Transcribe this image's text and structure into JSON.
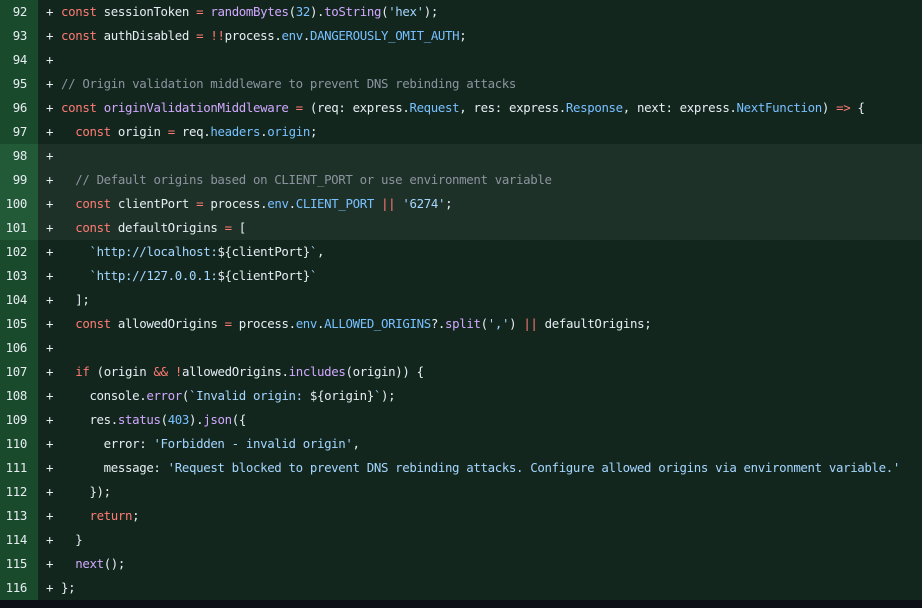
{
  "colors": {
    "keyword": "#ff7b72",
    "function": "#d2a8ff",
    "string": "#a5d6ff",
    "constant": "#79c0ff",
    "comment": "#8b949e",
    "plain": "#e6edf3",
    "added_line_bg": "#12261e",
    "added_gutter_bg": "#1a4a2c",
    "selected_line_bg": "#1e3128"
  },
  "lines": [
    {
      "num": "92",
      "marker": "+",
      "tokens": [
        [
          "kw",
          "const"
        ],
        [
          "plain",
          " sessionToken "
        ],
        [
          "kw",
          "="
        ],
        [
          "plain",
          " "
        ],
        [
          "fn",
          "randomBytes"
        ],
        [
          "plain",
          "("
        ],
        [
          "const",
          "32"
        ],
        [
          "plain",
          ")."
        ],
        [
          "fn",
          "toString"
        ],
        [
          "plain",
          "("
        ],
        [
          "str",
          "'hex'"
        ],
        [
          "plain",
          ");"
        ]
      ]
    },
    {
      "num": "93",
      "marker": "+",
      "tokens": [
        [
          "kw",
          "const"
        ],
        [
          "plain",
          " authDisabled "
        ],
        [
          "kw",
          "="
        ],
        [
          "plain",
          " "
        ],
        [
          "kw",
          "!!"
        ],
        [
          "plain",
          "process."
        ],
        [
          "const",
          "env"
        ],
        [
          "plain",
          "."
        ],
        [
          "const",
          "DANGEROUSLY_OMIT_AUTH"
        ],
        [
          "plain",
          ";"
        ]
      ]
    },
    {
      "num": "94",
      "marker": "+",
      "tokens": []
    },
    {
      "num": "95",
      "marker": "+",
      "tokens": [
        [
          "cm",
          "// Origin validation middleware to prevent DNS rebinding attacks"
        ]
      ]
    },
    {
      "num": "96",
      "marker": "+",
      "tokens": [
        [
          "kw",
          "const"
        ],
        [
          "plain",
          " "
        ],
        [
          "fn",
          "originValidationMiddleware"
        ],
        [
          "plain",
          " "
        ],
        [
          "kw",
          "="
        ],
        [
          "plain",
          " (req: express."
        ],
        [
          "const",
          "Request"
        ],
        [
          "plain",
          ", res: express."
        ],
        [
          "const",
          "Response"
        ],
        [
          "plain",
          ", next: express."
        ],
        [
          "const",
          "NextFunction"
        ],
        [
          "plain",
          ") "
        ],
        [
          "kw",
          "=>"
        ],
        [
          "plain",
          " {"
        ]
      ]
    },
    {
      "num": "97",
      "marker": "+",
      "tokens": [
        [
          "plain",
          "  "
        ],
        [
          "kw",
          "const"
        ],
        [
          "plain",
          " origin "
        ],
        [
          "kw",
          "="
        ],
        [
          "plain",
          " req."
        ],
        [
          "const",
          "headers"
        ],
        [
          "plain",
          "."
        ],
        [
          "const",
          "origin"
        ],
        [
          "plain",
          ";"
        ]
      ]
    },
    {
      "num": "98",
      "marker": "+",
      "hl": true,
      "tokens": []
    },
    {
      "num": "99",
      "marker": "+",
      "hl": true,
      "tokens": [
        [
          "plain",
          "  "
        ],
        [
          "cm",
          "// Default origins based on CLIENT_PORT or use environment variable"
        ]
      ]
    },
    {
      "num": "100",
      "marker": "+",
      "hl": true,
      "tokens": [
        [
          "plain",
          "  "
        ],
        [
          "kw",
          "const"
        ],
        [
          "plain",
          " clientPort "
        ],
        [
          "kw",
          "="
        ],
        [
          "plain",
          " process."
        ],
        [
          "const",
          "env"
        ],
        [
          "plain",
          "."
        ],
        [
          "const",
          "CLIENT_PORT"
        ],
        [
          "plain",
          " "
        ],
        [
          "kw",
          "||"
        ],
        [
          "plain",
          " "
        ],
        [
          "str",
          "'6274'"
        ],
        [
          "plain",
          ";"
        ]
      ]
    },
    {
      "num": "101",
      "marker": "+",
      "hl": true,
      "tokens": [
        [
          "plain",
          "  "
        ],
        [
          "kw",
          "const"
        ],
        [
          "plain",
          " defaultOrigins "
        ],
        [
          "kw",
          "="
        ],
        [
          "plain",
          " ["
        ]
      ]
    },
    {
      "num": "102",
      "marker": "+",
      "tokens": [
        [
          "plain",
          "    "
        ],
        [
          "str",
          "`http://localhost:"
        ],
        [
          "plain",
          "${clientPort}"
        ],
        [
          "str",
          "`"
        ],
        [
          "plain",
          ","
        ]
      ]
    },
    {
      "num": "103",
      "marker": "+",
      "tokens": [
        [
          "plain",
          "    "
        ],
        [
          "str",
          "`http://127.0.0.1:"
        ],
        [
          "plain",
          "${clientPort}"
        ],
        [
          "str",
          "`"
        ]
      ]
    },
    {
      "num": "104",
      "marker": "+",
      "tokens": [
        [
          "plain",
          "  ];"
        ]
      ]
    },
    {
      "num": "105",
      "marker": "+",
      "tokens": [
        [
          "plain",
          "  "
        ],
        [
          "kw",
          "const"
        ],
        [
          "plain",
          " allowedOrigins "
        ],
        [
          "kw",
          "="
        ],
        [
          "plain",
          " process."
        ],
        [
          "const",
          "env"
        ],
        [
          "plain",
          "."
        ],
        [
          "const",
          "ALLOWED_ORIGINS"
        ],
        [
          "plain",
          "?."
        ],
        [
          "fn",
          "split"
        ],
        [
          "plain",
          "("
        ],
        [
          "str",
          "','"
        ],
        [
          "plain",
          ") "
        ],
        [
          "kw",
          "||"
        ],
        [
          "plain",
          " defaultOrigins;"
        ]
      ]
    },
    {
      "num": "106",
      "marker": "+",
      "tokens": []
    },
    {
      "num": "107",
      "marker": "+",
      "tokens": [
        [
          "plain",
          "  "
        ],
        [
          "kw",
          "if"
        ],
        [
          "plain",
          " (origin "
        ],
        [
          "kw",
          "&&"
        ],
        [
          "plain",
          " "
        ],
        [
          "kw",
          "!"
        ],
        [
          "plain",
          "allowedOrigins."
        ],
        [
          "fn",
          "includes"
        ],
        [
          "plain",
          "(origin)) {"
        ]
      ]
    },
    {
      "num": "108",
      "marker": "+",
      "tokens": [
        [
          "plain",
          "    console."
        ],
        [
          "fn",
          "error"
        ],
        [
          "plain",
          "("
        ],
        [
          "str",
          "`Invalid origin: "
        ],
        [
          "plain",
          "${origin}"
        ],
        [
          "str",
          "`"
        ],
        [
          "plain",
          ");"
        ]
      ]
    },
    {
      "num": "109",
      "marker": "+",
      "tokens": [
        [
          "plain",
          "    res."
        ],
        [
          "fn",
          "status"
        ],
        [
          "plain",
          "("
        ],
        [
          "const",
          "403"
        ],
        [
          "plain",
          ")."
        ],
        [
          "fn",
          "json"
        ],
        [
          "plain",
          "({"
        ]
      ]
    },
    {
      "num": "110",
      "marker": "+",
      "tokens": [
        [
          "plain",
          "      error: "
        ],
        [
          "str",
          "'Forbidden - invalid origin'"
        ],
        [
          "plain",
          ","
        ]
      ]
    },
    {
      "num": "111",
      "marker": "+",
      "tokens": [
        [
          "plain",
          "      message: "
        ],
        [
          "str",
          "'Request blocked to prevent DNS rebinding attacks. Configure allowed origins via environment variable.'"
        ]
      ]
    },
    {
      "num": "112",
      "marker": "+",
      "tokens": [
        [
          "plain",
          "    });"
        ]
      ]
    },
    {
      "num": "113",
      "marker": "+",
      "tokens": [
        [
          "plain",
          "    "
        ],
        [
          "kw",
          "return"
        ],
        [
          "plain",
          ";"
        ]
      ]
    },
    {
      "num": "114",
      "marker": "+",
      "tokens": [
        [
          "plain",
          "  }"
        ]
      ]
    },
    {
      "num": "115",
      "marker": "+",
      "tokens": [
        [
          "plain",
          "  "
        ],
        [
          "fn",
          "next"
        ],
        [
          "plain",
          "();"
        ]
      ]
    },
    {
      "num": "116",
      "marker": "+",
      "tokens": [
        [
          "plain",
          "};"
        ]
      ]
    }
  ]
}
